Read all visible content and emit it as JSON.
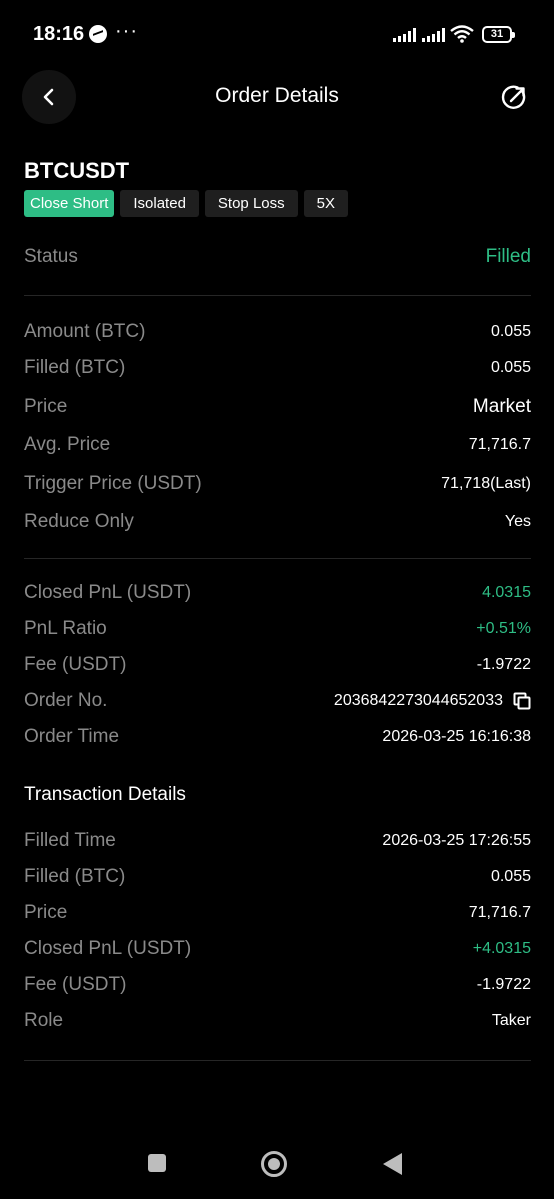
{
  "status_bar": {
    "time": "18:16",
    "dots": "···",
    "battery": "31"
  },
  "nav": {
    "title": "Order Details"
  },
  "order": {
    "pair": "BTCUSDT",
    "tags": [
      "Close Short",
      "Isolated",
      "Stop Loss",
      "5X"
    ],
    "status_label": "Status",
    "status_value": "Filled"
  },
  "details": [
    {
      "label": "Amount (BTC)",
      "value": "0.055"
    },
    {
      "label": "Filled (BTC)",
      "value": "0.055"
    },
    {
      "label": "Price",
      "value": "Market"
    },
    {
      "label": "Avg. Price",
      "value": "71,716.7"
    },
    {
      "label": "Trigger Price (USDT)",
      "value": "71,718(Last)"
    },
    {
      "label": "Reduce Only",
      "value": "Yes"
    }
  ],
  "pnl": [
    {
      "label": "Closed PnL (USDT)",
      "value": "4.0315"
    },
    {
      "label": "PnL Ratio",
      "value": "+0.51%"
    },
    {
      "label": "Fee (USDT)",
      "value": "-1.9722"
    },
    {
      "label": "Order No.",
      "value": "2036842273044652033"
    },
    {
      "label": "Order Time",
      "value": "2026-03-25 16:16:38"
    }
  ],
  "transaction": {
    "title": "Transaction Details",
    "rows": [
      {
        "label": "Filled Time",
        "value": "2026-03-25 17:26:55"
      },
      {
        "label": "Filled (BTC)",
        "value": "0.055"
      },
      {
        "label": "Price",
        "value": "71,716.7"
      },
      {
        "label": "Closed PnL (USDT)",
        "value": "+4.0315"
      },
      {
        "label": "Fee (USDT)",
        "value": "-1.9722"
      },
      {
        "label": "Role",
        "value": "Taker"
      }
    ]
  },
  "colors": {
    "accent_green": "#2ebd85",
    "label_gray": "#8a8a8a",
    "background": "#000000"
  },
  "icons": {
    "back": "chevron-left-icon",
    "share": "share-icon",
    "copy": "copy-icon"
  }
}
